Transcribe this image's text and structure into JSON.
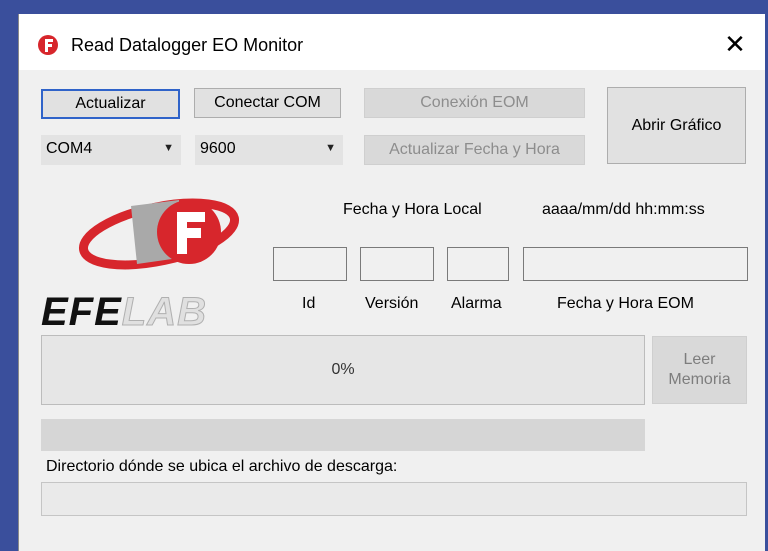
{
  "window": {
    "title": "Read Datalogger EO Monitor",
    "close_glyph": "✕"
  },
  "buttons": {
    "actualizar": "Actualizar",
    "conectar_com": "Conectar COM",
    "conexion_eom": "Conexión EOM",
    "actualizar_fecha": "Actualizar Fecha y Hora",
    "abrir_grafico": "Abrir Gráfico",
    "leer_memoria_line1": "Leer",
    "leer_memoria_line2": "Memoria"
  },
  "combos": {
    "port": "COM4",
    "baud": "9600",
    "arrow": "▼"
  },
  "labels": {
    "fecha_local": "Fecha y Hora Local",
    "fecha_format": "aaaa/mm/dd hh:mm:ss",
    "id": "Id",
    "version": "Versión",
    "alarma": "Alarma",
    "fecha_eom": "Fecha y Hora EOM",
    "directorio": "Directorio dónde se ubica el archivo de descarga:"
  },
  "progress": {
    "text": "0%",
    "value": 0
  },
  "logo": {
    "text_dark": "EFE",
    "text_light": "LAB"
  },
  "colors": {
    "brand_red": "#d7262c",
    "focus_blue": "#2f63c9"
  }
}
